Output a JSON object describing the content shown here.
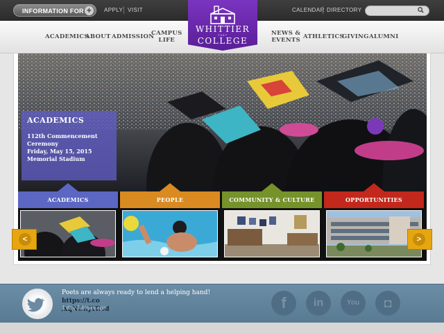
{
  "topbar": {
    "info_label": "INFORMATION FOR",
    "info_toggle": "+",
    "links": [
      "APPLY",
      "VISIT"
    ],
    "right_links": [
      "CALENDAR",
      "DIRECTORY"
    ],
    "search_placeholder": ""
  },
  "logo": {
    "name_top": "WHITTIER",
    "founded": "1887",
    "name_bottom": "COLLEGE"
  },
  "nav": {
    "left": [
      "ACADEMICS",
      "ABOUT",
      "ADMISSION"
    ],
    "campus_line1": "CAMPUS",
    "campus_line2": "LIFE",
    "news_line1": "NEWS &",
    "news_line2": "EVENTS",
    "right": [
      "ATHLETICS",
      "GIVING",
      "ALUMNI"
    ]
  },
  "hero": {
    "caption_title": "ACADEMICS",
    "caption_lines": [
      "112th Commencement",
      "Ceremony",
      "Friday, May 15, 2015",
      "Memorial Stadium"
    ]
  },
  "tiles": [
    {
      "label": "ACADEMICS",
      "color": "#5b67c3"
    },
    {
      "label": "PEOPLE",
      "color": "#d98a20"
    },
    {
      "label": "COMMUNITY & CULTURE",
      "color": "#76922b"
    },
    {
      "label": "OPPORTUNITIES",
      "color": "#c2281c"
    }
  ],
  "carousel": {
    "prev": "<",
    "next": ">"
  },
  "footer": {
    "tweet_text": "Poets are always ready to lend a helping hand! ",
    "tweet_link_a": "https://t.co",
    "tweet_link_b": "/xqNCwJYRod",
    "tweet_time": "1 day 3 hours ago",
    "social": [
      {
        "icon": "facebook-icon",
        "glyph": "f"
      },
      {
        "icon": "linkedin-icon",
        "glyph": "in"
      },
      {
        "icon": "youtube-icon",
        "glyph": "You"
      },
      {
        "icon": "instagram-icon",
        "glyph": "◘"
      }
    ]
  }
}
